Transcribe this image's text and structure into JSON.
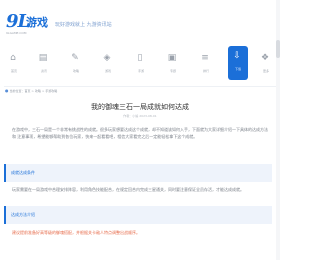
{
  "header": {
    "logo_mark": "9L",
    "logo_text": "游戏",
    "logo_sub": "9LGAME.COM",
    "slogan": "玩好游戏就上 九游资讯站"
  },
  "nav": {
    "items": [
      {
        "label": "首页",
        "icon": "home-icon",
        "glyph": "⌂"
      },
      {
        "label": "资讯",
        "icon": "news-icon",
        "glyph": "▤"
      },
      {
        "label": "攻略",
        "icon": "guide-icon",
        "glyph": "✎"
      },
      {
        "label": "游戏",
        "icon": "gamepad-icon",
        "glyph": "◈"
      },
      {
        "label": "手游",
        "icon": "phone-icon",
        "glyph": "▯"
      },
      {
        "label": "专题",
        "icon": "topic-icon",
        "glyph": "▣"
      },
      {
        "label": "排行",
        "icon": "rank-icon",
        "glyph": "≡"
      },
      {
        "label": "下载",
        "icon": "download-icon",
        "glyph": "⇩"
      },
      {
        "label": "更多",
        "icon": "more-icon",
        "glyph": "❖"
      }
    ],
    "active_label": "攻略",
    "active_glyph": "✎"
  },
  "breadcrumb": "当前位置：首页 > 攻略 > 手游攻略",
  "article": {
    "title": "我的御魂三石一局成就如何达成",
    "meta": "作者：小编    2023-08-01",
    "intro_1": "在游戏中，三石一局是一个非常有挑战性的成就。很多玩家想要达成这个成就，却不知道该如何入手，下面就为大家详细介绍一下具体的达成方法和",
    "intro_2": "注意事项，希望能够帮助到各位玩家，快来一起看看吧，相信大家看完之后一定能轻松拿下这个成就。",
    "section_1": "成就达成条件",
    "section_2": "达成方法介绍",
    "body_1": "玩家需要在一局游戏中合理安排阵容，利用角色技能配合，在规定回合内完成三星通关，同时要注意保证全员存活，才能达成成就。",
    "body_2": "建议提前准备好高等级的御魂搭配，并根据关卡敌人特点调整出战顺序。"
  },
  "colors": {
    "accent": "#1b6fd8",
    "highlight": "#e66b4a"
  }
}
